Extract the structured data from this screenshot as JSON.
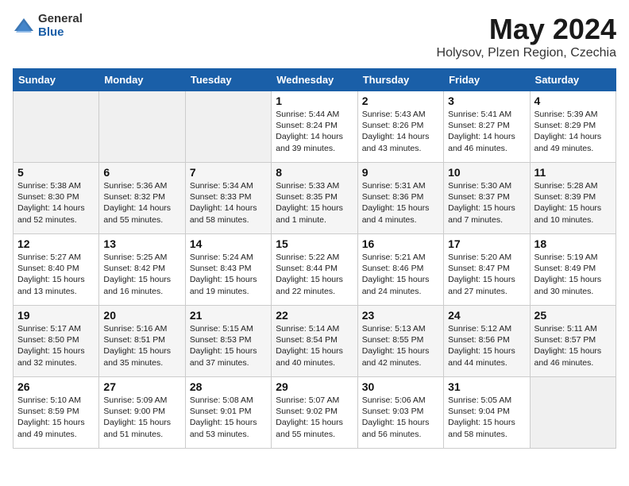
{
  "header": {
    "logo_general": "General",
    "logo_blue": "Blue",
    "title": "May 2024",
    "location": "Holysov, Plzen Region, Czechia"
  },
  "weekdays": [
    "Sunday",
    "Monday",
    "Tuesday",
    "Wednesday",
    "Thursday",
    "Friday",
    "Saturday"
  ],
  "weeks": [
    [
      {
        "day": "",
        "info": ""
      },
      {
        "day": "",
        "info": ""
      },
      {
        "day": "",
        "info": ""
      },
      {
        "day": "1",
        "info": "Sunrise: 5:44 AM\nSunset: 8:24 PM\nDaylight: 14 hours\nand 39 minutes."
      },
      {
        "day": "2",
        "info": "Sunrise: 5:43 AM\nSunset: 8:26 PM\nDaylight: 14 hours\nand 43 minutes."
      },
      {
        "day": "3",
        "info": "Sunrise: 5:41 AM\nSunset: 8:27 PM\nDaylight: 14 hours\nand 46 minutes."
      },
      {
        "day": "4",
        "info": "Sunrise: 5:39 AM\nSunset: 8:29 PM\nDaylight: 14 hours\nand 49 minutes."
      }
    ],
    [
      {
        "day": "5",
        "info": "Sunrise: 5:38 AM\nSunset: 8:30 PM\nDaylight: 14 hours\nand 52 minutes."
      },
      {
        "day": "6",
        "info": "Sunrise: 5:36 AM\nSunset: 8:32 PM\nDaylight: 14 hours\nand 55 minutes."
      },
      {
        "day": "7",
        "info": "Sunrise: 5:34 AM\nSunset: 8:33 PM\nDaylight: 14 hours\nand 58 minutes."
      },
      {
        "day": "8",
        "info": "Sunrise: 5:33 AM\nSunset: 8:35 PM\nDaylight: 15 hours\nand 1 minute."
      },
      {
        "day": "9",
        "info": "Sunrise: 5:31 AM\nSunset: 8:36 PM\nDaylight: 15 hours\nand 4 minutes."
      },
      {
        "day": "10",
        "info": "Sunrise: 5:30 AM\nSunset: 8:37 PM\nDaylight: 15 hours\nand 7 minutes."
      },
      {
        "day": "11",
        "info": "Sunrise: 5:28 AM\nSunset: 8:39 PM\nDaylight: 15 hours\nand 10 minutes."
      }
    ],
    [
      {
        "day": "12",
        "info": "Sunrise: 5:27 AM\nSunset: 8:40 PM\nDaylight: 15 hours\nand 13 minutes."
      },
      {
        "day": "13",
        "info": "Sunrise: 5:25 AM\nSunset: 8:42 PM\nDaylight: 15 hours\nand 16 minutes."
      },
      {
        "day": "14",
        "info": "Sunrise: 5:24 AM\nSunset: 8:43 PM\nDaylight: 15 hours\nand 19 minutes."
      },
      {
        "day": "15",
        "info": "Sunrise: 5:22 AM\nSunset: 8:44 PM\nDaylight: 15 hours\nand 22 minutes."
      },
      {
        "day": "16",
        "info": "Sunrise: 5:21 AM\nSunset: 8:46 PM\nDaylight: 15 hours\nand 24 minutes."
      },
      {
        "day": "17",
        "info": "Sunrise: 5:20 AM\nSunset: 8:47 PM\nDaylight: 15 hours\nand 27 minutes."
      },
      {
        "day": "18",
        "info": "Sunrise: 5:19 AM\nSunset: 8:49 PM\nDaylight: 15 hours\nand 30 minutes."
      }
    ],
    [
      {
        "day": "19",
        "info": "Sunrise: 5:17 AM\nSunset: 8:50 PM\nDaylight: 15 hours\nand 32 minutes."
      },
      {
        "day": "20",
        "info": "Sunrise: 5:16 AM\nSunset: 8:51 PM\nDaylight: 15 hours\nand 35 minutes."
      },
      {
        "day": "21",
        "info": "Sunrise: 5:15 AM\nSunset: 8:53 PM\nDaylight: 15 hours\nand 37 minutes."
      },
      {
        "day": "22",
        "info": "Sunrise: 5:14 AM\nSunset: 8:54 PM\nDaylight: 15 hours\nand 40 minutes."
      },
      {
        "day": "23",
        "info": "Sunrise: 5:13 AM\nSunset: 8:55 PM\nDaylight: 15 hours\nand 42 minutes."
      },
      {
        "day": "24",
        "info": "Sunrise: 5:12 AM\nSunset: 8:56 PM\nDaylight: 15 hours\nand 44 minutes."
      },
      {
        "day": "25",
        "info": "Sunrise: 5:11 AM\nSunset: 8:57 PM\nDaylight: 15 hours\nand 46 minutes."
      }
    ],
    [
      {
        "day": "26",
        "info": "Sunrise: 5:10 AM\nSunset: 8:59 PM\nDaylight: 15 hours\nand 49 minutes."
      },
      {
        "day": "27",
        "info": "Sunrise: 5:09 AM\nSunset: 9:00 PM\nDaylight: 15 hours\nand 51 minutes."
      },
      {
        "day": "28",
        "info": "Sunrise: 5:08 AM\nSunset: 9:01 PM\nDaylight: 15 hours\nand 53 minutes."
      },
      {
        "day": "29",
        "info": "Sunrise: 5:07 AM\nSunset: 9:02 PM\nDaylight: 15 hours\nand 55 minutes."
      },
      {
        "day": "30",
        "info": "Sunrise: 5:06 AM\nSunset: 9:03 PM\nDaylight: 15 hours\nand 56 minutes."
      },
      {
        "day": "31",
        "info": "Sunrise: 5:05 AM\nSunset: 9:04 PM\nDaylight: 15 hours\nand 58 minutes."
      },
      {
        "day": "",
        "info": ""
      }
    ]
  ]
}
